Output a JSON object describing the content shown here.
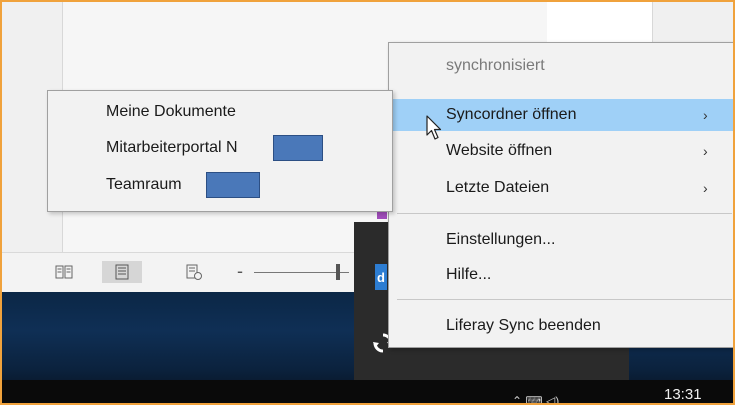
{
  "context_menu": {
    "status": "synchronisiert",
    "items": [
      {
        "label": "Syncordner öffnen",
        "submenu": true
      },
      {
        "label": "Website öffnen",
        "submenu": true
      },
      {
        "label": "Letzte Dateien",
        "submenu": true
      },
      {
        "label": "Einstellungen..."
      },
      {
        "label": "Hilfe..."
      },
      {
        "label": "Liferay Sync beenden"
      }
    ],
    "arrow": "›"
  },
  "submenu": {
    "items": [
      {
        "label": "Meine Dokumente"
      },
      {
        "label": "Mitarbeiterportal N"
      },
      {
        "label": "Teamraum"
      }
    ]
  },
  "taskbar": {
    "clock": "13:31",
    "tray_text": "⌃ ⌨ ◁) ",
    "tray_letter": "d"
  },
  "colors": {
    "highlight": "#9fd0f7",
    "redaction": "#4a78b9",
    "frame_border": "#f0a23c"
  }
}
